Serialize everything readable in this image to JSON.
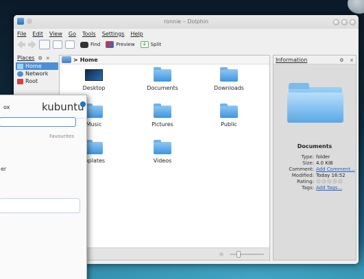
{
  "window": {
    "title": "ronnie – Dolphin"
  },
  "menubar": [
    "File",
    "Edit",
    "View",
    "Go",
    "Tools",
    "Settings",
    "Help"
  ],
  "toolbar": {
    "find": "Find",
    "preview": "Preview",
    "split": "Split"
  },
  "places": {
    "title": "Places",
    "items": [
      {
        "label": "Home",
        "icon": "home-icon",
        "active": true
      },
      {
        "label": "Network",
        "icon": "network-icon"
      },
      {
        "label": "Root",
        "icon": "root-icon"
      }
    ]
  },
  "breadcrumb": {
    "separator": ">",
    "current": "Home"
  },
  "files": [
    {
      "name": "Desktop",
      "icon": "desktop-icon"
    },
    {
      "name": "Documents",
      "icon": "folder-icon"
    },
    {
      "name": "Downloads",
      "icon": "folder-icon"
    },
    {
      "name": "Music",
      "icon": "folder-icon"
    },
    {
      "name": "Pictures",
      "icon": "folder-icon"
    },
    {
      "name": "Public",
      "icon": "folder-icon"
    },
    {
      "name": "mplates",
      "icon": "folder-icon"
    },
    {
      "name": "Videos",
      "icon": "folder-icon"
    }
  ],
  "info": {
    "title": "Information",
    "name": "Documents",
    "type_label": "Type:",
    "type": "folder",
    "size_label": "Size:",
    "size": "4.0 KiB",
    "comment_label": "Comment:",
    "comment": "Add Comment...",
    "modified_label": "Modified:",
    "modified": "Today 16:52",
    "rating_label": "Rating:",
    "tags_label": "Tags:",
    "tags": "Add Tags..."
  },
  "kubuntu": {
    "title_fragment": "ox",
    "logo": "kubuntu",
    "favourites": "Favourites",
    "text_fragment": "er"
  },
  "colors": {
    "accent": "#4d8fd6",
    "link": "#1f5fbf"
  }
}
